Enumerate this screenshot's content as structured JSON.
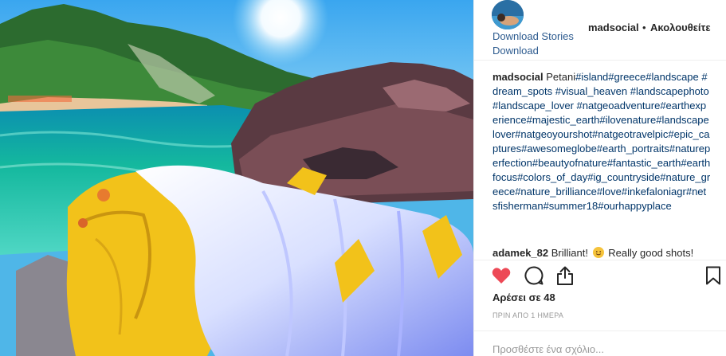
{
  "post": {
    "photo": {
      "description_icon": "photo-beach-fishing-nets",
      "colors": {
        "sky": "#4fb6e8",
        "sea": "#17b8a6",
        "net_yellow": "#f2c21a",
        "net_white": "#e9ecff"
      }
    },
    "header": {
      "download_stories": "Download Stories",
      "download": "Download",
      "username": "madsocial",
      "dot": "•",
      "follow_status": "Ακολουθείτε"
    },
    "caption": {
      "username": "madsocial",
      "text": "Petani",
      "hashtags": "#island#greece#landscape #dream_spots #visual_heaven #landscapephoto #landscape_lover #natgeoadventure#earthexperience#majestic_earth#ilovenature#landscapelover#natgeoyourshot#natgeotravelpic#epic_captures#awesomeglobe#earth_portraits#natureperfection#beautyofnature#fantastic_earth#earthfocus#colors_of_day#ig_countryside#nature_greece#nature_brilliance#love#inkefaloniagr#netsfisherman#summer18#ourhappyplace"
    },
    "comments": [
      {
        "username": "adamek_82",
        "before_emoji": "Brilliant!",
        "emoji": "smiling-face-emoji",
        "after_emoji": "Really good shots!"
      }
    ],
    "actions": {
      "like_icon": "heart-icon",
      "comment_icon": "comment-icon",
      "share_icon": "share-icon",
      "save_icon": "bookmark-icon",
      "like_color": "#ed4956"
    },
    "likes": "Αρέσει σε 48",
    "timestamp": "ΠΡΙΝ ΑΠΟ 1 ΗΜΕΡΑ",
    "add_comment": {
      "placeholder": "Προσθέστε ένα σχόλιο..."
    }
  }
}
